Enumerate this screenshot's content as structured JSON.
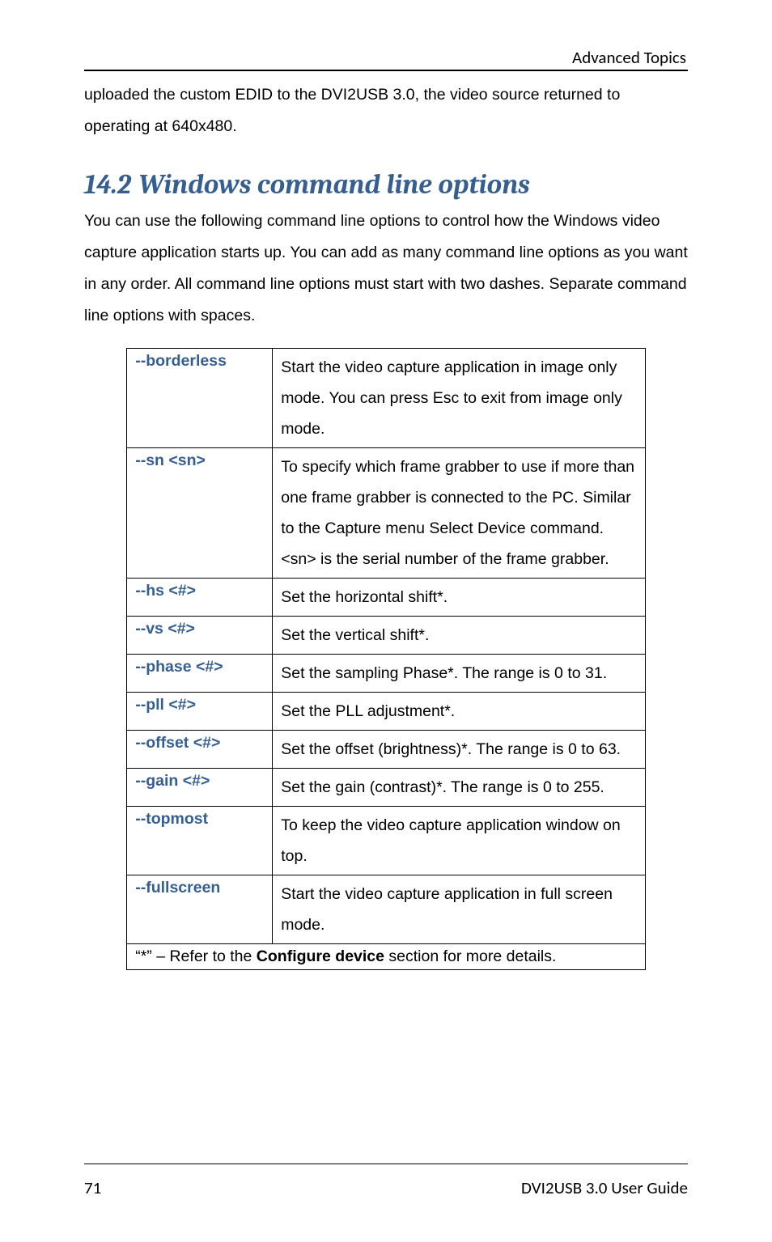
{
  "header": {
    "running_head": "Advanced Topics"
  },
  "lead_para": "uploaded the custom EDID to the DVI2USB 3.0, the video source returned to operating at 640x480.",
  "section": {
    "number": "14.2",
    "title": "Windows command line options",
    "intro": "You can use the following command line options to control how the Windows video capture application starts up. You can add as many command line options as you want in any order. All command line options must start with two dashes. Separate command line options with spaces."
  },
  "options": [
    {
      "flag": "--borderless",
      "desc": "Start the video capture application in image only mode. You can press Esc to exit from image only mode."
    },
    {
      "flag": "--sn <sn>",
      "desc": "To specify which frame grabber to use if more than one frame grabber is connected to the PC. Similar to the Capture menu Select Device command.\n<sn> is the serial number of the frame grabber."
    },
    {
      "flag": "--hs <#>",
      "desc": "Set the horizontal shift*."
    },
    {
      "flag": "--vs <#>",
      "desc": "Set the vertical shift*."
    },
    {
      "flag": "--phase <#>",
      "desc": "Set the sampling Phase*. The range is 0 to 31."
    },
    {
      "flag": "--pll <#>",
      "desc": "Set the PLL adjustment*."
    },
    {
      "flag": "--offset <#>",
      "desc": "Set the offset (brightness)*. The range is 0 to 63."
    },
    {
      "flag": "--gain <#>",
      "desc": "Set the gain (contrast)*. The range is 0 to 255."
    },
    {
      "flag": "--topmost",
      "desc": "To keep the video capture application window on top."
    },
    {
      "flag": "--fullscreen",
      "desc": "Start the video capture application in full screen mode."
    }
  ],
  "table_footer": {
    "prefix": "“*” – Refer to the ",
    "bold": "Configure device",
    "suffix": " section for more details."
  },
  "footer": {
    "page_number": "71",
    "doc_title": "DVI2USB 3.0  User Guide"
  }
}
